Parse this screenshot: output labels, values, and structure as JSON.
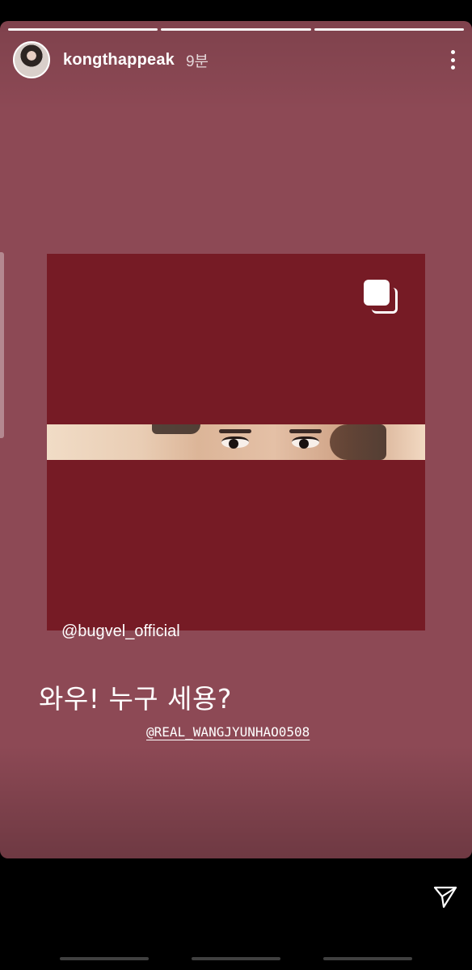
{
  "story": {
    "username": "kongthappeak",
    "time": "9분",
    "progress_segments": 3,
    "mention": "@bugvel_official",
    "caption": "와우! 누구 세용?",
    "tag": "@REAL_WANGJYUNHAO0508"
  },
  "icons": {
    "more": "more-options-icon",
    "carousel": "multiple-posts-icon",
    "send": "send-paper-plane-icon"
  },
  "colors": {
    "story_background": "#8d4955",
    "post_background": "#761b25"
  }
}
